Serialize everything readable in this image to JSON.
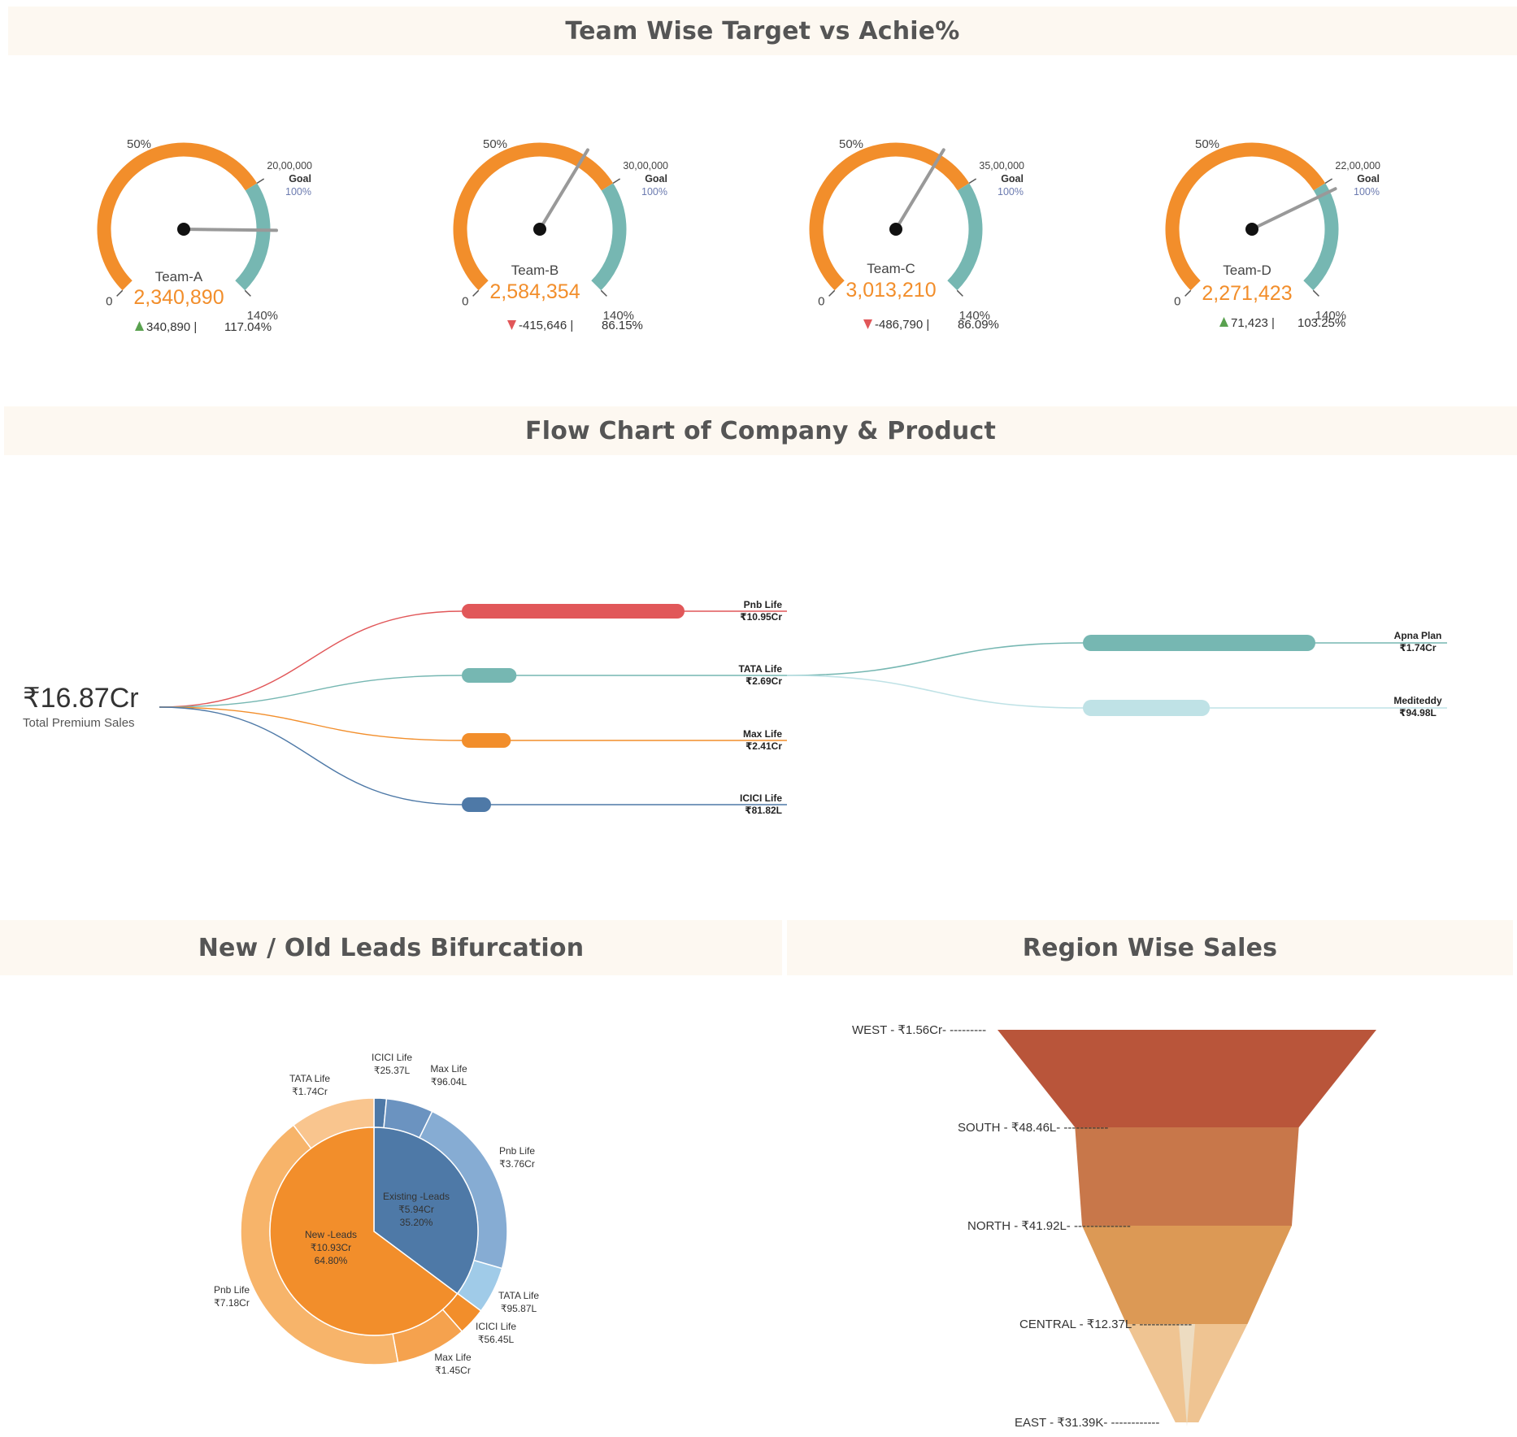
{
  "sections": {
    "gauges_title": "Team Wise Target vs Achie%",
    "flow_title": "Flow Chart of Company & Product",
    "leads_title": "New / Old Leads Bifurcation",
    "region_title": "Region Wise Sales"
  },
  "colors": {
    "orange": "#f28e2b",
    "teal": "#76b7b2",
    "red": "#e15759",
    "blue": "#4e79a7",
    "light_blue": "#a0cbe8",
    "light_orange": "#f7b46a",
    "needle": "#999999",
    "up": "#59a14f",
    "down": "#e15759",
    "value_orange": "#f28e2b",
    "banner_bg": "#fdf8f1"
  },
  "chart_data": [
    {
      "type": "gauge",
      "gauge_labels": {
        "zero": "0",
        "half": "50%",
        "max": "140%",
        "goal": "Goal",
        "goal_pct": "100%"
      },
      "teams": [
        {
          "name": "Team-A",
          "actual_label": "2,340,890",
          "actual": 2340890,
          "target_label": "20,00,000",
          "target": 2000000,
          "variance_label": "340,890",
          "direction": "up",
          "achievement_label": "117.04%",
          "achievement": 117.04
        },
        {
          "name": "Team-B",
          "actual_label": "2,584,354",
          "actual": 2584354,
          "target_label": "30,00,000",
          "target": 3000000,
          "variance_label": "-415,646",
          "direction": "down",
          "achievement_label": "86.15%",
          "achievement": 86.15
        },
        {
          "name": "Team-C",
          "actual_label": "3,013,210",
          "actual": 3013210,
          "target_label": "35,00,000",
          "target": 3500000,
          "variance_label": "-486,790",
          "direction": "down",
          "achievement_label": "86.09%",
          "achievement": 86.09
        },
        {
          "name": "Team-D",
          "actual_label": "2,271,423",
          "actual": 2271423,
          "target_label": "22,00,000",
          "target": 2200000,
          "variance_label": "71,423",
          "direction": "up",
          "achievement_label": "103.25%",
          "achievement": 103.25
        }
      ]
    },
    {
      "type": "flow",
      "total_label": "₹16.87Cr",
      "total_sub": "Total Premium Sales",
      "companies": [
        {
          "name": "Pnb Life",
          "value_label": "₹10.95Cr",
          "value_cr": 10.95,
          "color": "#e15759"
        },
        {
          "name": "TATA Life",
          "value_label": "₹2.69Cr",
          "value_cr": 2.69,
          "color": "#76b7b2"
        },
        {
          "name": "Max Life",
          "value_label": "₹2.41Cr",
          "value_cr": 2.41,
          "color": "#f28e2b"
        },
        {
          "name": "ICICI Life",
          "value_label": "₹81.82L",
          "value_cr": 0.8182,
          "color": "#4e79a7"
        }
      ],
      "products": [
        {
          "name": "Apna Plan",
          "value_label": "₹1.74Cr",
          "value_cr": 1.74,
          "from": "TATA Life",
          "color": "#76b7b2"
        },
        {
          "name": "Mediteddy",
          "value_label": "₹94.98L",
          "value_cr": 0.9498,
          "from": "TATA Life",
          "color": "#bfe2e6"
        }
      ]
    },
    {
      "type": "pie",
      "inner": [
        {
          "name": "Existing -Leads",
          "value_label": "₹5.94Cr",
          "pct_label": "35.20%",
          "value_cr": 5.94,
          "color": "#4e79a7"
        },
        {
          "name": "New -Leads",
          "value_label": "₹10.93Cr",
          "pct_label": "64.80%",
          "value_cr": 10.93,
          "color": "#f28e2b"
        }
      ],
      "outer": [
        {
          "name": "ICICI Life",
          "value_label": "₹25.37L",
          "value_cr": 0.2537,
          "group": "Existing -Leads",
          "color": "#4e79a7"
        },
        {
          "name": "Max Life",
          "value_label": "₹96.04L",
          "value_cr": 0.9604,
          "group": "Existing -Leads",
          "color": "#6b93c0"
        },
        {
          "name": "Pnb Life",
          "value_label": "₹3.76Cr",
          "value_cr": 3.76,
          "group": "Existing -Leads",
          "color": "#86acd3"
        },
        {
          "name": "TATA Life",
          "value_label": "₹95.87L",
          "value_cr": 0.9587,
          "group": "Existing -Leads",
          "color": "#a0cbe8"
        },
        {
          "name": "ICICI Life",
          "value_label": "₹56.45L",
          "value_cr": 0.5645,
          "group": "New -Leads",
          "color": "#f28e2b"
        },
        {
          "name": "Max Life",
          "value_label": "₹1.45Cr",
          "value_cr": 1.45,
          "group": "New -Leads",
          "color": "#f5a24e"
        },
        {
          "name": "Pnb Life",
          "value_label": "₹7.18Cr",
          "value_cr": 7.18,
          "group": "New -Leads",
          "color": "#f7b46a"
        },
        {
          "name": "TATA Life",
          "value_label": "₹1.74Cr",
          "value_cr": 1.74,
          "group": "New -Leads",
          "color": "#f9c58e"
        }
      ]
    },
    {
      "type": "funnel",
      "stages": [
        {
          "name": "WEST",
          "label": "WEST - ₹1.56Cr- ---------",
          "value_cr": 1.56,
          "color": "#b9553a"
        },
        {
          "name": "SOUTH",
          "label": "SOUTH - ₹48.46L- -----------",
          "value_cr": 0.4846,
          "color": "#c8774a"
        },
        {
          "name": "NORTH",
          "label": "NORTH - ₹41.92L- --------------",
          "value_cr": 0.4192,
          "color": "#dc9955"
        },
        {
          "name": "CENTRAL",
          "label": "CENTRAL - ₹12.37L- -------------",
          "value_cr": 0.1237,
          "color": "#efc492"
        },
        {
          "name": "EAST",
          "label": "EAST - ₹31.39K- ------------",
          "value_cr": 0.003139,
          "color": "#eddcc1"
        }
      ]
    }
  ]
}
